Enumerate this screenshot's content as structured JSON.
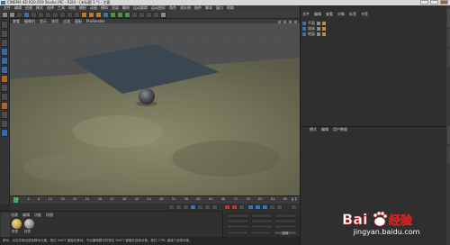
{
  "window": {
    "title": "CINEMA 4D R20.059 Studio (RC - R20) - [未标题 1 *] - 主要",
    "icon": "cinema4d-icon"
  },
  "menubar": {
    "items": [
      "文件",
      "编辑",
      "创建",
      "模式",
      "选择",
      "工具",
      "网格",
      "捕捉",
      "动画",
      "模拟",
      "渲染",
      "雕刻",
      "运动跟踪",
      "运动图形",
      "角色",
      "流水线",
      "插件",
      "脚本",
      "窗口",
      "帮助"
    ]
  },
  "viewport": {
    "menu": [
      "查看",
      "摄像机",
      "显示",
      "选项",
      "过滤",
      "面板",
      "ProRender"
    ],
    "perspective_label": "透视视图",
    "colors": {
      "floor": "#6f6e58",
      "plane": "#3a4650",
      "sphere": "#4a4e52"
    }
  },
  "timeline": {
    "ticks": [
      "0",
      "2",
      "4",
      "6",
      "8",
      "10",
      "12",
      "14",
      "16",
      "18",
      "20",
      "22",
      "24",
      "26",
      "28",
      "30",
      "32",
      "34",
      "36",
      "38",
      "40",
      "42",
      "44",
      "46",
      "48",
      "50",
      "52",
      "54",
      "56",
      "58",
      "60",
      "62",
      "64",
      "66",
      "68",
      "70",
      "72",
      "74",
      "76",
      "78",
      "80",
      "82",
      "84",
      "86",
      "88",
      "90"
    ],
    "end_frame": "0 F"
  },
  "materials": {
    "menu": [
      "创建",
      "编辑",
      "功能",
      "纹理"
    ],
    "items": [
      {
        "label": "材质",
        "color": "#c8a64a"
      },
      {
        "label": "材质",
        "color": "#8e9092"
      }
    ]
  },
  "coordinates": {
    "apply_label": "应用"
  },
  "statusbar": {
    "text": "移动：点击并拖动鼠标移动元素。按住 SHIFT 键量化移动；节点编辑模式时按住 SHIFT 键增加选择对象；按住 CTRL 键减少选择对象。"
  },
  "object_manager": {
    "menu": [
      "文件",
      "编辑",
      "查看",
      "对象",
      "标签",
      "书签"
    ],
    "objects": [
      {
        "name": "平面"
      },
      {
        "name": "球体"
      },
      {
        "name": "地面"
      }
    ]
  },
  "attribute_manager": {
    "menu": [
      "模式",
      "编辑",
      "用户数据"
    ]
  },
  "watermark": {
    "brand": "Bai",
    "brand2": "du",
    "cn": "经验",
    "url": "jingyan.baidu.com"
  }
}
